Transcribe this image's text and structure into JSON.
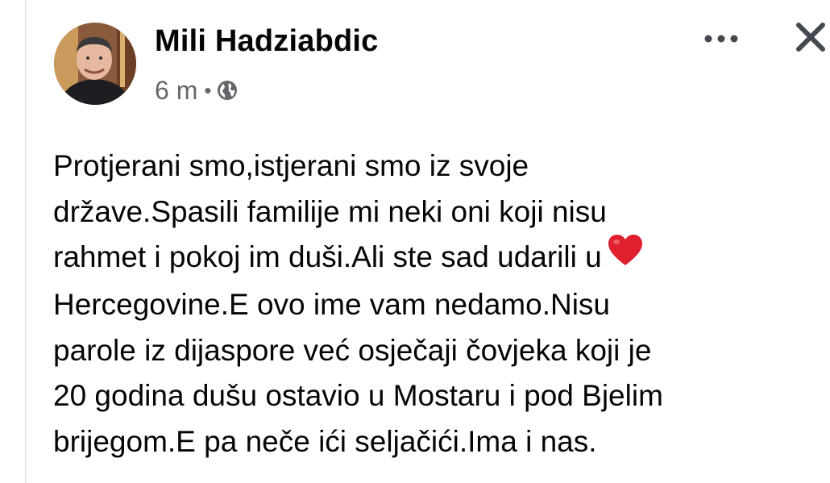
{
  "post": {
    "author": {
      "name": "Mili Hadziabdic",
      "avatar_icon": "profile-photo"
    },
    "time": "6 m",
    "separator": "•",
    "audience_icon": "globe-icon",
    "actions": {
      "more_icon": "more-dots-icon",
      "close_icon": "close-icon"
    },
    "text_lines": [
      "Protjerani smo,istjerani smo iz svoje",
      "države.Spasili familije mi neki oni koji nisu",
      "rahmet i pokoj im duši.Ali ste sad udarili u",
      "Hercegovine.E ovo ime vam nedamo.Nisu",
      "parole iz dijaspore već osječaji čovjeka koji je",
      "20 godina dušu ostavio u Mostaru i pod Bjelim",
      "brijegom.E pa neče ići seljačići.Ima i nas."
    ],
    "emoji": "heart-emoji",
    "colors": {
      "text": "#050505",
      "secondary": "#65676b",
      "heart": "#e0202e"
    }
  }
}
